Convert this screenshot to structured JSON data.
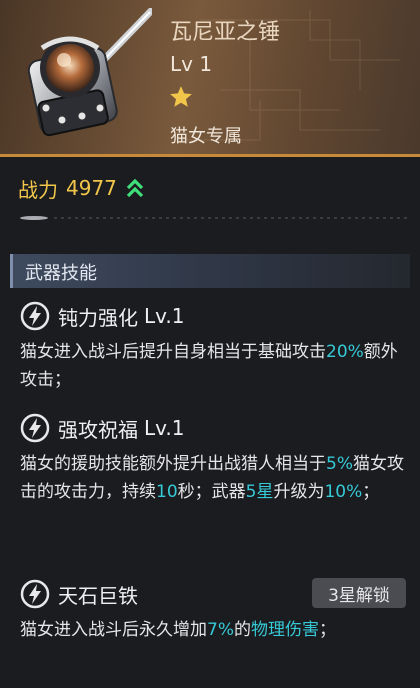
{
  "weapon": {
    "name": "瓦尼亚之锤",
    "level": "Lv 1",
    "stars": 1,
    "exclusive": "猫女专属",
    "star_color": "#f1c64a"
  },
  "power": {
    "label": "战力",
    "value": "4977",
    "icon": "double-chevron-up-icon"
  },
  "section": {
    "title": "武器技能"
  },
  "skills": [
    {
      "name": "钝力强化",
      "level": "Lv.1",
      "icon": "lightning-icon",
      "desc": [
        {
          "t": "猫女进入战斗后提升自身相当于基础攻击"
        },
        {
          "t": "20%",
          "hl": true
        },
        {
          "t": "额外攻击；"
        }
      ]
    },
    {
      "name": "强攻祝福",
      "level": "Lv.1",
      "icon": "lightning-icon",
      "desc": [
        {
          "t": "猫女的援助技能额外提升出战猎人相当于"
        },
        {
          "t": "5%",
          "hl": true
        },
        {
          "t": "猫女攻击的攻击力，持续"
        },
        {
          "t": "10",
          "hl": true
        },
        {
          "t": "秒；武器"
        },
        {
          "t": "5星",
          "hl": true
        },
        {
          "t": "升级为"
        },
        {
          "t": "10%",
          "hl": true
        },
        {
          "t": "；"
        }
      ]
    },
    {
      "name": "天石巨铁",
      "level": "",
      "icon": "lightning-icon",
      "lock": "3星解锁",
      "desc": [
        {
          "t": "猫女进入战斗后永久增加"
        },
        {
          "t": "7%",
          "hl": true
        },
        {
          "t": "的"
        },
        {
          "t": "物理伤害",
          "hl": true
        },
        {
          "t": "；"
        }
      ]
    }
  ],
  "colors": {
    "highlight": "#36c9d6",
    "power": "#f1c64a",
    "up_arrow": "#3fe07a"
  }
}
